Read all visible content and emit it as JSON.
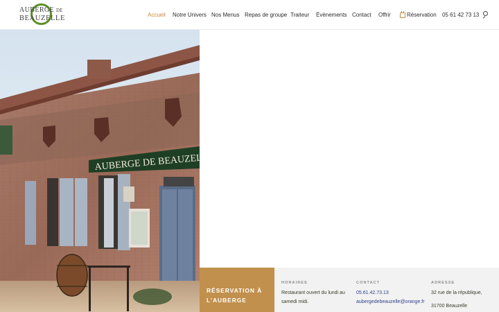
{
  "logo": {
    "line1": "AUBERGE",
    "line1_small": "DE",
    "line2": "BEAUZELLE"
  },
  "nav": {
    "items": [
      {
        "label": "Accueil",
        "active": true
      },
      {
        "label": "Notre Univers",
        "active": false
      },
      {
        "label": "Nos Menus",
        "active": false
      },
      {
        "label": "Repas de groupe",
        "active": false
      },
      {
        "label": "Traiteur",
        "active": false
      },
      {
        "label": "Évènements",
        "active": false
      },
      {
        "label": "Contact",
        "active": false
      },
      {
        "label": "Offrir",
        "active": false
      }
    ],
    "reservation_label": "Réservation",
    "phone": "05 61 42 73 13",
    "icons": {
      "reservation": "calendar-icon",
      "search": "search-icon"
    },
    "accent_color": "#c68a3d"
  },
  "hero": {
    "sign_text": "AUBERGE DE BEAUZELLE"
  },
  "info": {
    "reservation_title": "RÉSERVATION À L'AUBERGE",
    "horaires": {
      "label": "HORAIRES",
      "text": "Restaurant ouvert du lundi au samedi midi."
    },
    "contact": {
      "label": "CONTACT",
      "phone": "05.61.42.73.13",
      "email": "aubergedebeauzelle@orange.fr"
    },
    "adresse": {
      "label": "ADRESSE",
      "street": "32 rue de la république,",
      "city": "31700 Beauzelle"
    },
    "brand_color": "#c1904c"
  }
}
